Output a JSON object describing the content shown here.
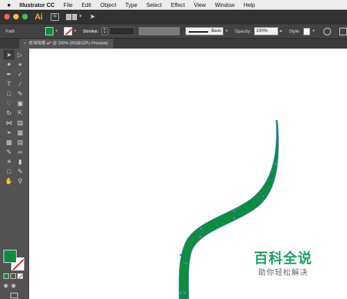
{
  "menubar": {
    "app_name": "Illustrator CC",
    "items": [
      "File",
      "Edit",
      "Object",
      "Type",
      "Select",
      "Effect",
      "View",
      "Window",
      "Help"
    ]
  },
  "appbar": {
    "logo": "Ai",
    "bridge_label": "St"
  },
  "control_bar": {
    "selection_type": "Path",
    "fill_color": "#0c8e3e",
    "stroke_label": "Stroke:",
    "stroke_weight": "",
    "brush_label": "Basic",
    "opacity_label": "Opacity:",
    "opacity_value": "100%",
    "style_label": "Style:"
  },
  "document_tab": {
    "title": "老海陆慢.ai* @ 200% (RGB/GPU Preview)"
  },
  "colors": {
    "fill": "#0c8e3e",
    "stroke": "none",
    "anchor": "#4d7fd1"
  },
  "watermark": {
    "title": "百科全说",
    "subtitle": "助你轻松解决"
  }
}
